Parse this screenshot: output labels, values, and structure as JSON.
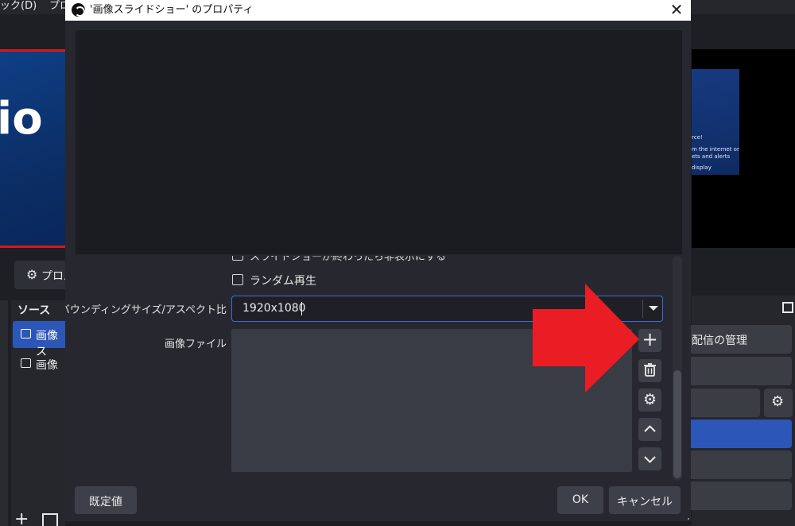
{
  "background": {
    "menu_items": [
      "ック(D)",
      "プロ"
    ],
    "left_preview_text": "io",
    "right_preview_lines": [
      "rce!",
      "m the internet or",
      "ets and alerts",
      "display"
    ],
    "properties_button_label": "プロパ",
    "sources": {
      "title": "ソース",
      "items": [
        {
          "label": "画像ス",
          "icon": "slideshow-icon",
          "selected": true
        },
        {
          "label": "画像",
          "icon": "image-icon",
          "selected": false
        }
      ]
    },
    "controls": {
      "manage_stream_label": "配信の管理"
    },
    "colors": {
      "accent": "#2c56b8",
      "brand_red": "#d11b1b"
    }
  },
  "dialog": {
    "title": "'画像スライドショー' のプロパティ",
    "close_glyph": "✕",
    "partial_checkbox_label": "スライドショーが終わったら非表示にする",
    "random_playback_label": "ランダム再生",
    "random_playback_checked": false,
    "bounding_label": "バウンディングサイズ/アスペクト比",
    "bounding_value": "1920x1080",
    "image_files_label": "画像ファイル",
    "side_buttons": [
      {
        "name": "add",
        "glyph": "+"
      },
      {
        "name": "remove",
        "glyph": "🗑"
      },
      {
        "name": "properties",
        "glyph": "⚙"
      },
      {
        "name": "move-up",
        "glyph": "︿"
      },
      {
        "name": "move-down",
        "glyph": "﹀"
      }
    ],
    "defaults_label": "既定値",
    "ok_label": "OK",
    "cancel_label": "キャンセル"
  },
  "annotation": {
    "arrow_color": "#ea1c24",
    "points_to": "add-file-button"
  }
}
